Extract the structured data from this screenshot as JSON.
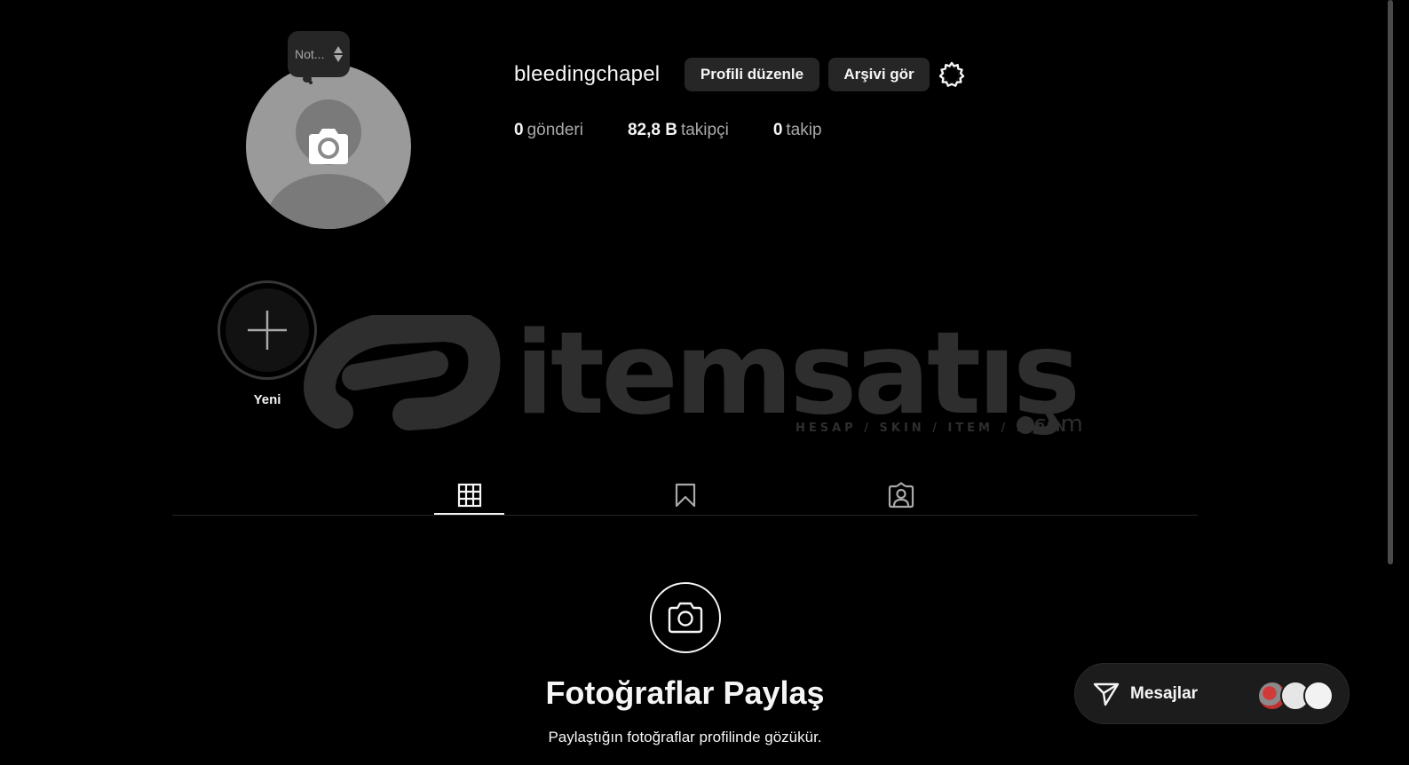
{
  "profile": {
    "username": "bleedingchapel",
    "note_text": "Not...",
    "edit_profile_label": "Profili düzenle",
    "view_archive_label": "Arşivi gör"
  },
  "stats": [
    {
      "value": "0",
      "label": "gönderi"
    },
    {
      "value": "82,8 B",
      "label": "takipçi"
    },
    {
      "value": "0",
      "label": "takip"
    }
  ],
  "highlights": {
    "new_label": "Yeni"
  },
  "watermark": {
    "brand": "itemsatış",
    "tagline": "HESAP / SKIN / ITEM / E-PIN",
    "suffix": ".com"
  },
  "tabs": [
    {
      "icon": "grid-icon",
      "active": true
    },
    {
      "icon": "bookmark-icon",
      "active": false
    },
    {
      "icon": "tagged-user-icon",
      "active": false
    }
  ],
  "empty_state": {
    "icon": "camera-icon",
    "title": "Fotoğraflar Paylaş",
    "subtitle": "Paylaştığın fotoğraflar profilinde gözükür."
  },
  "messages": {
    "label": "Mesajlar",
    "icon": "paper-plane-icon"
  },
  "colors": {
    "background": "#000000",
    "button": "#262626",
    "text": "#f5f5f5",
    "muted": "#a8a8a8"
  }
}
